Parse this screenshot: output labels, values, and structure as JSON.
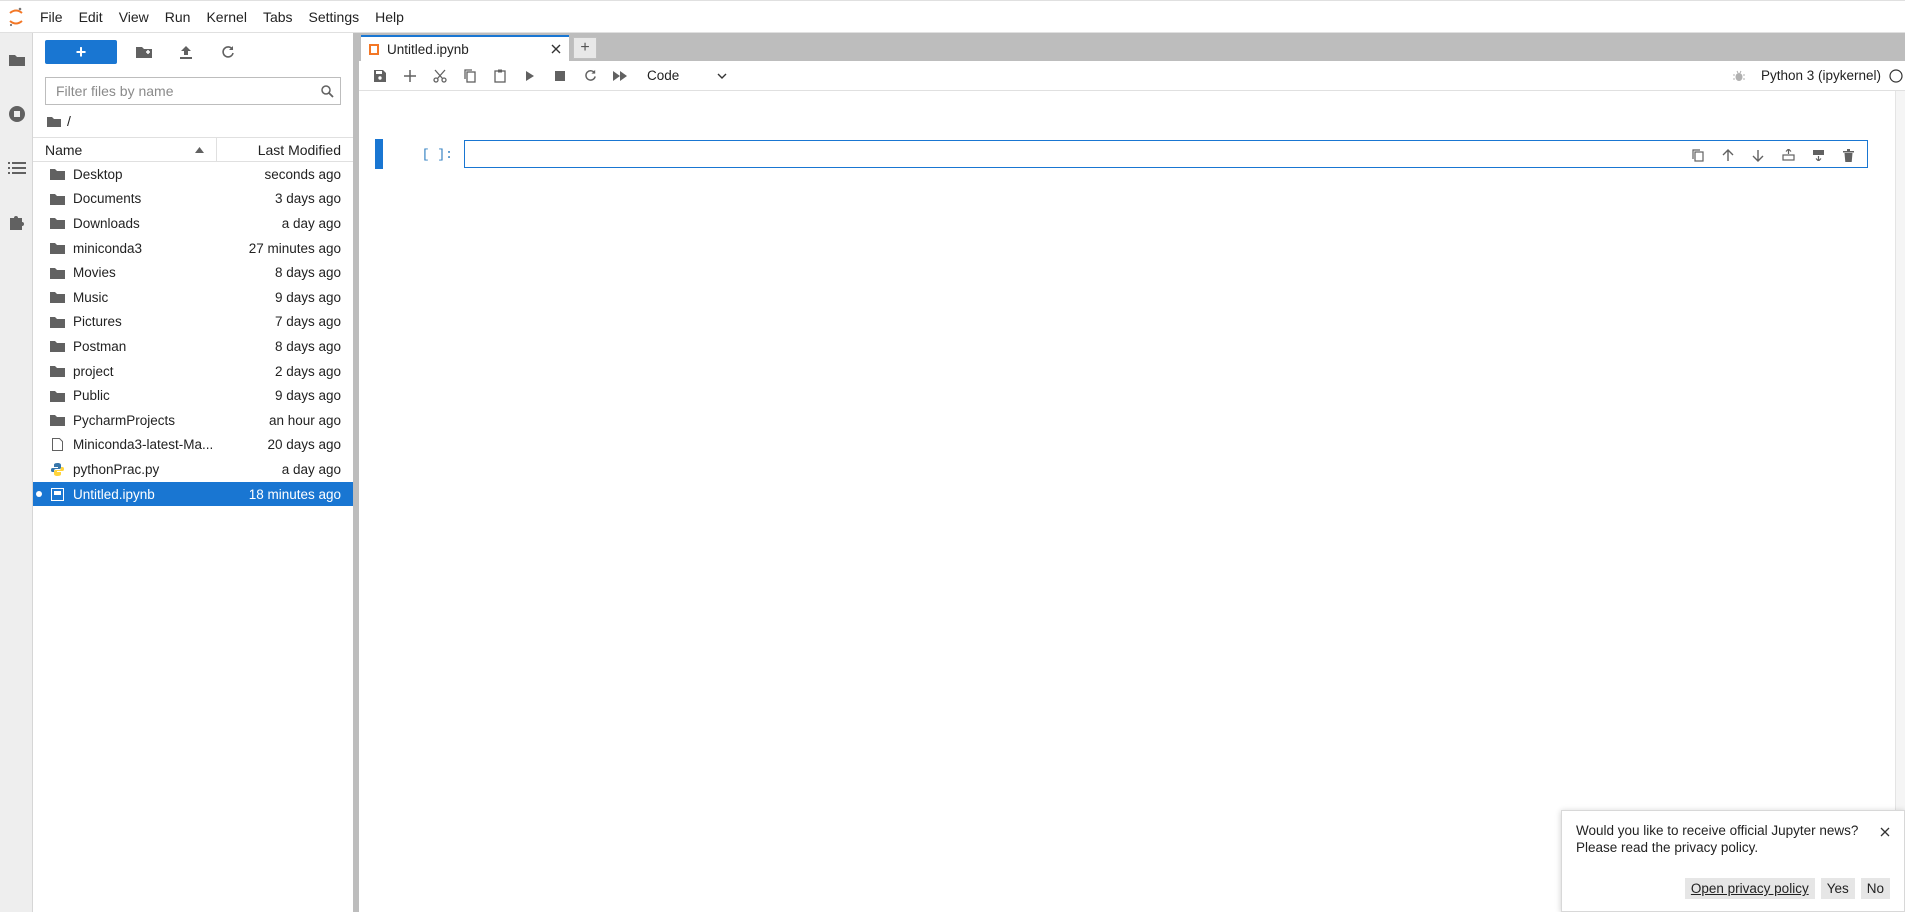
{
  "menubar": {
    "items": [
      "File",
      "Edit",
      "View",
      "Run",
      "Kernel",
      "Tabs",
      "Settings",
      "Help"
    ]
  },
  "activity_bar": {
    "icons": [
      "folder-icon",
      "stop-circle-icon",
      "list-icon",
      "puzzle-icon"
    ]
  },
  "file_browser": {
    "new_button": "+",
    "search": {
      "placeholder": "Filter files by name",
      "value": ""
    },
    "breadcrumb": "/",
    "columns": {
      "name": "Name",
      "modified": "Last Modified"
    },
    "files": [
      {
        "name": "Desktop",
        "modified": "seconds ago",
        "type": "folder"
      },
      {
        "name": "Documents",
        "modified": "3 days ago",
        "type": "folder"
      },
      {
        "name": "Downloads",
        "modified": "a day ago",
        "type": "folder"
      },
      {
        "name": "miniconda3",
        "modified": "27 minutes ago",
        "type": "folder"
      },
      {
        "name": "Movies",
        "modified": "8 days ago",
        "type": "folder"
      },
      {
        "name": "Music",
        "modified": "9 days ago",
        "type": "folder"
      },
      {
        "name": "Pictures",
        "modified": "7 days ago",
        "type": "folder"
      },
      {
        "name": "Postman",
        "modified": "8 days ago",
        "type": "folder"
      },
      {
        "name": "project",
        "modified": "2 days ago",
        "type": "folder"
      },
      {
        "name": "Public",
        "modified": "9 days ago",
        "type": "folder"
      },
      {
        "name": "PycharmProjects",
        "modified": "an hour ago",
        "type": "folder"
      },
      {
        "name": "Miniconda3-latest-Ma...",
        "modified": "20 days ago",
        "type": "file"
      },
      {
        "name": "pythonPrac.py",
        "modified": "a day ago",
        "type": "python"
      },
      {
        "name": "Untitled.ipynb",
        "modified": "18 minutes ago",
        "type": "notebook",
        "selected": true,
        "running": true
      }
    ]
  },
  "tabs": {
    "active": "Untitled.ipynb",
    "add": "+"
  },
  "notebook_toolbar": {
    "cell_type": "Code",
    "kernel": "Python 3 (ipykernel)"
  },
  "cell": {
    "prompt": "[ ]:",
    "source": ""
  },
  "notification": {
    "message_line1": "Would you like to receive official Jupyter news?",
    "message_line2": "Please read the privacy policy.",
    "privacy_link": "Open privacy policy",
    "yes": "Yes",
    "no": "No"
  },
  "colors": {
    "accent": "#1976d2",
    "jupyter_orange": "#f37726"
  }
}
